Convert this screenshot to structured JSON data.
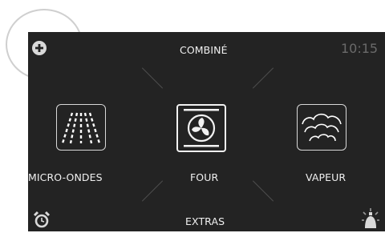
{
  "header": {
    "title": "COMBINÉ",
    "time": "10:15"
  },
  "modes": [
    {
      "label": "MICRO-ONDES",
      "icon": "microwave-waves-icon"
    },
    {
      "label": "FOUR",
      "icon": "oven-fan-icon",
      "selected": true
    },
    {
      "label": "VAPEUR",
      "icon": "steam-clouds-icon"
    }
  ],
  "footer": {
    "extras_label": "EXTRAS"
  },
  "icons": {
    "add": "plus-icon",
    "timer": "alarm-clock-icon",
    "light": "oven-light-icon"
  },
  "colors": {
    "background": "#232323",
    "text": "#f0f0f0",
    "clock": "#6a6a6a"
  }
}
